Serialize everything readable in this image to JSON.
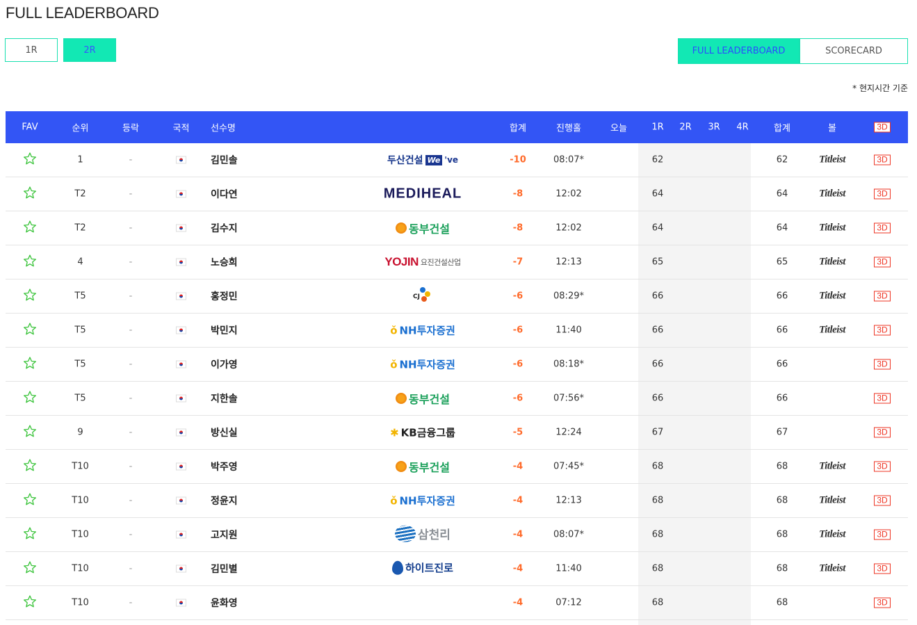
{
  "page": {
    "title": "FULL LEADERBOARD",
    "time_note": "* 현지시간 기준"
  },
  "round_tabs": [
    {
      "label": "1R",
      "active": false
    },
    {
      "label": "2R",
      "active": true
    }
  ],
  "view_tabs": [
    {
      "label": "FULL LEADERBOARD",
      "active": true
    },
    {
      "label": "SCORECARD",
      "active": false
    }
  ],
  "colors": {
    "accent": "#12e8b4",
    "header_bg": "#3355f5",
    "score_under_par": "#ff6a2a",
    "badge_3d": "#e32222"
  },
  "header": {
    "fav": "FAV",
    "rank": "순위",
    "move": "등락",
    "nat": "국적",
    "name": "선수명",
    "total": "합계",
    "hole": "진행홀",
    "today": "오늘",
    "r1": "1R",
    "r2": "2R",
    "r3": "3R",
    "r4": "4R",
    "sum": "합계",
    "ball": "볼",
    "view3d": "3D"
  },
  "players": [
    {
      "rank": "1",
      "move": "-",
      "name": "김민솔",
      "sponsor": "doosan",
      "total": "-10",
      "hole": "08:07*",
      "today": "",
      "r1": "62",
      "r2": "",
      "r3": "",
      "r4": "",
      "sum": "62",
      "ball": "Titleist",
      "view3d": "3D"
    },
    {
      "rank": "T2",
      "move": "-",
      "name": "이다연",
      "sponsor": "mediheal",
      "total": "-8",
      "hole": "12:02",
      "today": "",
      "r1": "64",
      "r2": "",
      "r3": "",
      "r4": "",
      "sum": "64",
      "ball": "Titleist",
      "view3d": "3D"
    },
    {
      "rank": "T2",
      "move": "-",
      "name": "김수지",
      "sponsor": "dongbu",
      "total": "-8",
      "hole": "12:02",
      "today": "",
      "r1": "64",
      "r2": "",
      "r3": "",
      "r4": "",
      "sum": "64",
      "ball": "Titleist",
      "view3d": "3D"
    },
    {
      "rank": "4",
      "move": "-",
      "name": "노승희",
      "sponsor": "yojin",
      "total": "-7",
      "hole": "12:13",
      "today": "",
      "r1": "65",
      "r2": "",
      "r3": "",
      "r4": "",
      "sum": "65",
      "ball": "Titleist",
      "view3d": "3D"
    },
    {
      "rank": "T5",
      "move": "-",
      "name": "홍정민",
      "sponsor": "cj",
      "total": "-6",
      "hole": "08:29*",
      "today": "",
      "r1": "66",
      "r2": "",
      "r3": "",
      "r4": "",
      "sum": "66",
      "ball": "Titleist",
      "view3d": "3D"
    },
    {
      "rank": "T5",
      "move": "-",
      "name": "박민지",
      "sponsor": "nh",
      "total": "-6",
      "hole": "11:40",
      "today": "",
      "r1": "66",
      "r2": "",
      "r3": "",
      "r4": "",
      "sum": "66",
      "ball": "Titleist",
      "view3d": "3D"
    },
    {
      "rank": "T5",
      "move": "-",
      "name": "이가영",
      "sponsor": "nh",
      "total": "-6",
      "hole": "08:18*",
      "today": "",
      "r1": "66",
      "r2": "",
      "r3": "",
      "r4": "",
      "sum": "66",
      "ball": "",
      "view3d": "3D"
    },
    {
      "rank": "T5",
      "move": "-",
      "name": "지한솔",
      "sponsor": "dongbu",
      "total": "-6",
      "hole": "07:56*",
      "today": "",
      "r1": "66",
      "r2": "",
      "r3": "",
      "r4": "",
      "sum": "66",
      "ball": "",
      "view3d": "3D"
    },
    {
      "rank": "9",
      "move": "-",
      "name": "방신실",
      "sponsor": "kb",
      "total": "-5",
      "hole": "12:24",
      "today": "",
      "r1": "67",
      "r2": "",
      "r3": "",
      "r4": "",
      "sum": "67",
      "ball": "",
      "view3d": "3D"
    },
    {
      "rank": "T10",
      "move": "-",
      "name": "박주영",
      "sponsor": "dongbu",
      "total": "-4",
      "hole": "07:45*",
      "today": "",
      "r1": "68",
      "r2": "",
      "r3": "",
      "r4": "",
      "sum": "68",
      "ball": "Titleist",
      "view3d": "3D"
    },
    {
      "rank": "T10",
      "move": "-",
      "name": "정윤지",
      "sponsor": "nh",
      "total": "-4",
      "hole": "12:13",
      "today": "",
      "r1": "68",
      "r2": "",
      "r3": "",
      "r4": "",
      "sum": "68",
      "ball": "Titleist",
      "view3d": "3D"
    },
    {
      "rank": "T10",
      "move": "-",
      "name": "고지원",
      "sponsor": "samchully",
      "total": "-4",
      "hole": "08:07*",
      "today": "",
      "r1": "68",
      "r2": "",
      "r3": "",
      "r4": "",
      "sum": "68",
      "ball": "Titleist",
      "view3d": "3D"
    },
    {
      "rank": "T10",
      "move": "-",
      "name": "김민별",
      "sponsor": "hite",
      "total": "-4",
      "hole": "11:40",
      "today": "",
      "r1": "68",
      "r2": "",
      "r3": "",
      "r4": "",
      "sum": "68",
      "ball": "Titleist",
      "view3d": "3D"
    },
    {
      "rank": "T10",
      "move": "-",
      "name": "윤화영",
      "sponsor": "",
      "total": "-4",
      "hole": "07:12",
      "today": "",
      "r1": "68",
      "r2": "",
      "r3": "",
      "r4": "",
      "sum": "68",
      "ball": "",
      "view3d": "3D"
    }
  ],
  "sponsors": {
    "doosan": {
      "text": "두산건설",
      "mark": "We",
      "mark2": "'ve"
    },
    "mediheal": {
      "text": "MEDIHEAL"
    },
    "dongbu": {
      "text": "동부건설"
    },
    "yojin": {
      "text": "YOJIN",
      "sub": "요진건설산업"
    },
    "cj": {
      "text": "CJ"
    },
    "nh": {
      "text": "NH투자증권",
      "mark": "ǒ"
    },
    "kb": {
      "text": "KB금융그룹",
      "mark": "✱"
    },
    "samchully": {
      "text": "삼천리"
    },
    "hite": {
      "text": "하이트진로"
    }
  }
}
